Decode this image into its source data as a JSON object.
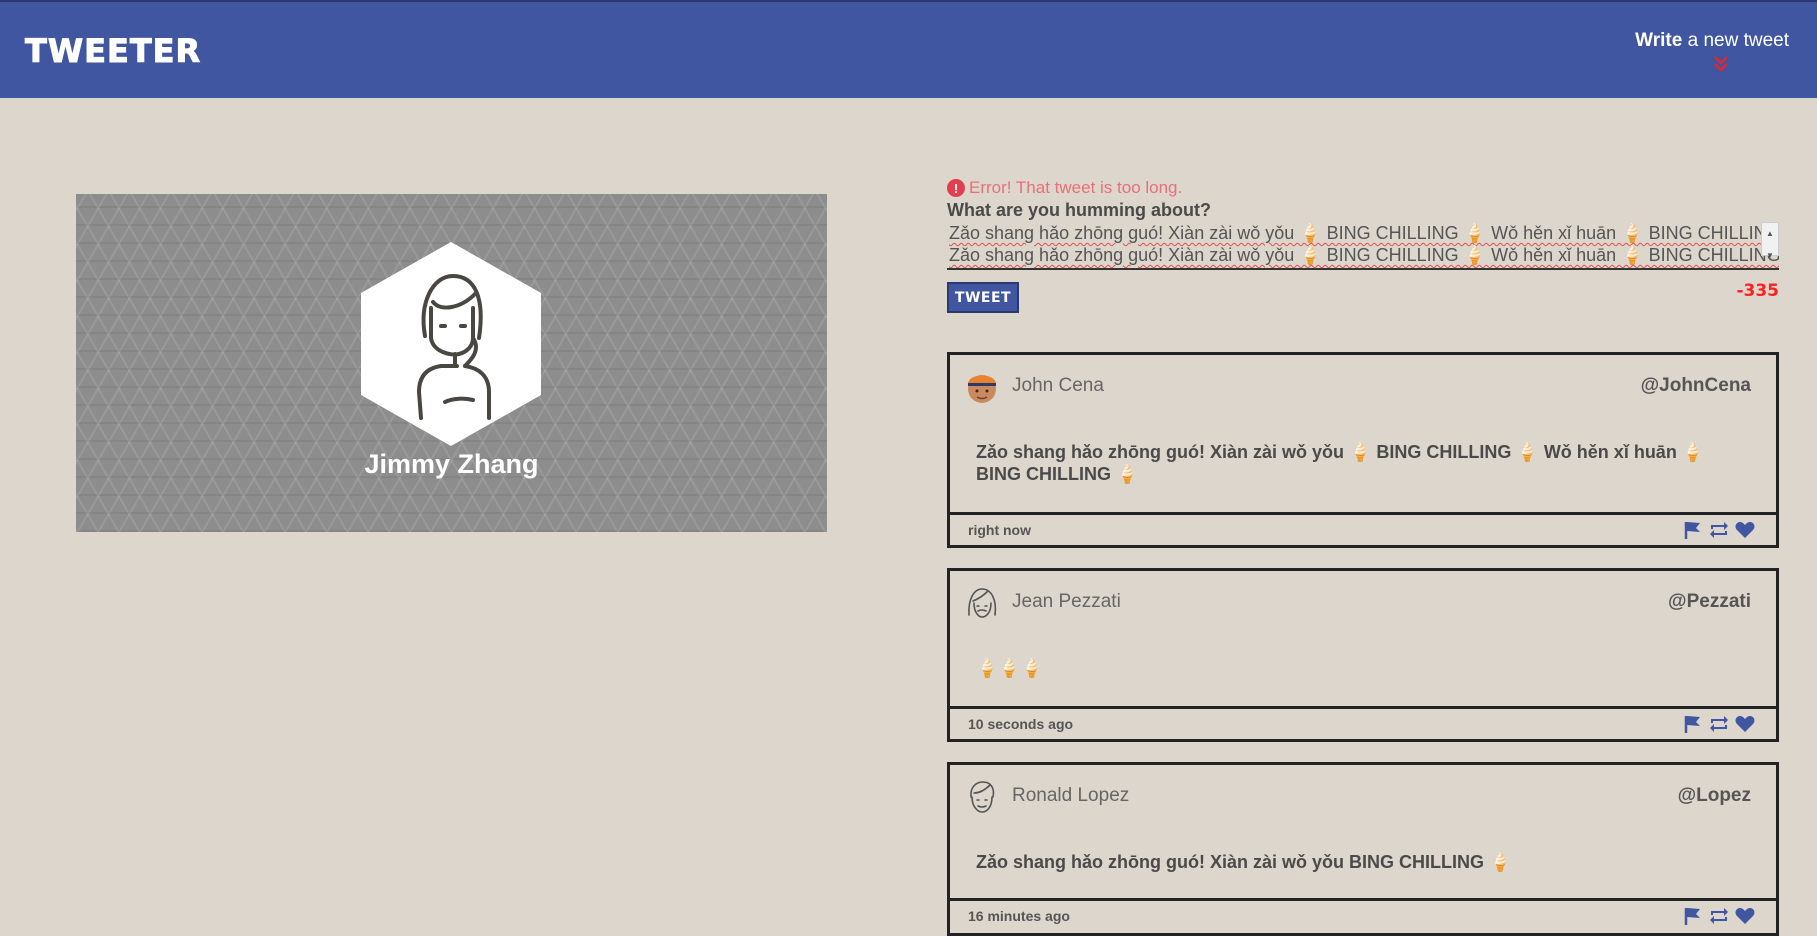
{
  "header": {
    "logo": "TWEETER",
    "write_bold": "Write",
    "write_rest": " a new tweet"
  },
  "profile": {
    "name": "Jimmy Zhang"
  },
  "compose": {
    "error": "Error! That tweet is too long.",
    "prompt": "What are you humming about?",
    "text_line": "Zǎo shang hǎo zhōng guó! Xiàn zài wǒ yǒu 🍦 BING CHILLING 🍦 Wǒ hěn xǐ huān 🍦 BING CHILLING 🍦",
    "button": "TWEET",
    "counter": "-335"
  },
  "tweets": [
    {
      "name": "John Cena",
      "handle": "@JohnCena",
      "text": "Zǎo shang hǎo zhōng guó! Xiàn zài wǒ yǒu 🍦 BING CHILLING 🍦 Wǒ hěn xǐ huān 🍦 BING CHILLING 🍦",
      "time": "right now"
    },
    {
      "name": "Jean Pezzati",
      "handle": "@Pezzati",
      "text": "🍦🍦🍦",
      "time": "10 seconds ago"
    },
    {
      "name": "Ronald Lopez",
      "handle": "@Lopez",
      "text": "Zǎo shang hǎo zhōng guó! Xiàn zài wǒ yǒu BING CHILLING 🍦",
      "time": "16 minutes ago"
    }
  ],
  "colors": {
    "nav": "#4056a1",
    "background": "#ddd6cc",
    "error": "#e8707a",
    "counter": "#ff2020"
  }
}
